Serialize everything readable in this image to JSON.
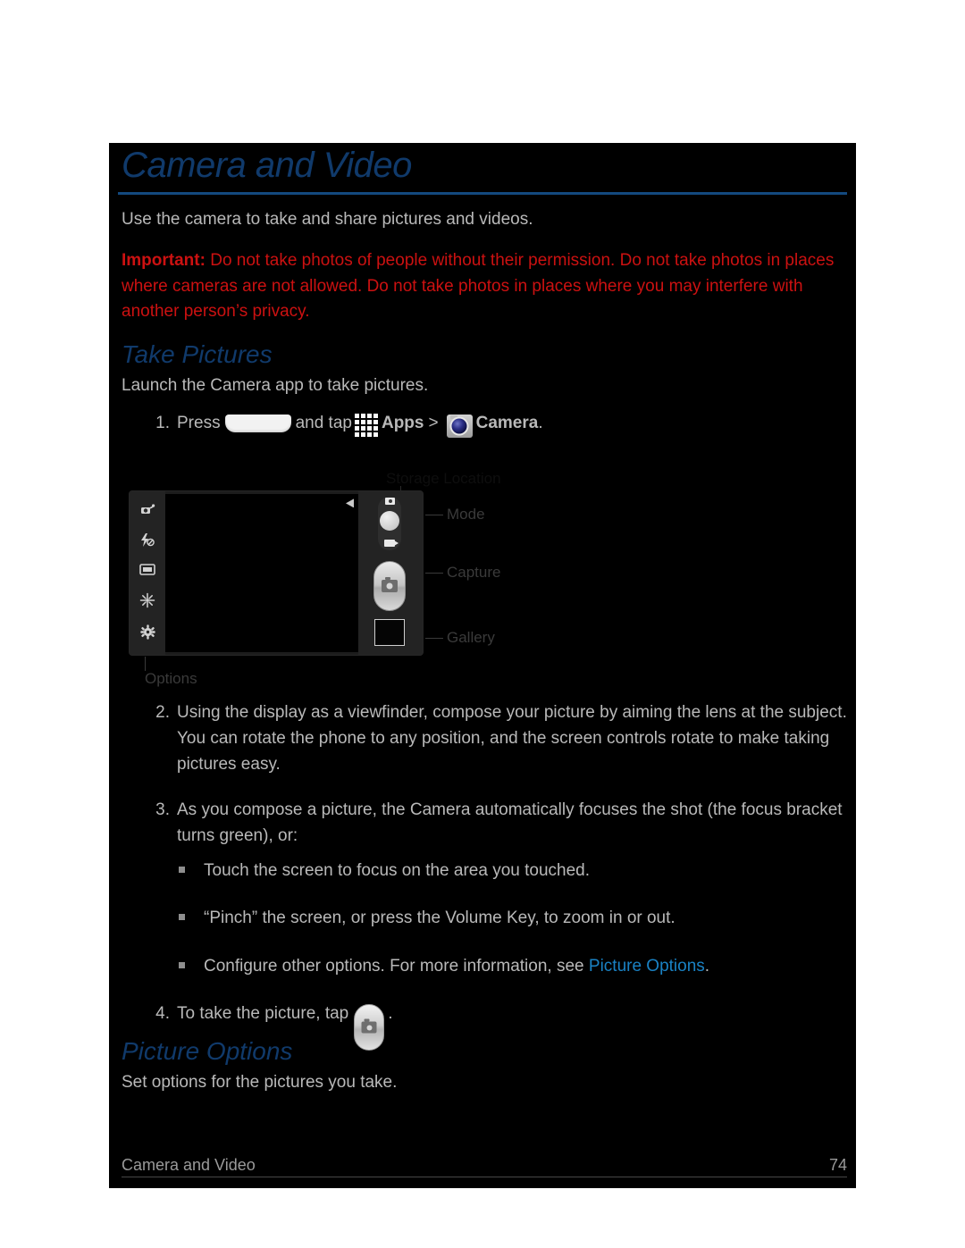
{
  "page": {
    "title": "Camera and Video",
    "intro": "Use the camera to take and share pictures and videos.",
    "important_label": "Important:",
    "important_text": " Do not take photos of people without their permission. Do not take photos in places where cameras are not allowed. Do not take photos in places where you may interfere with another person’s privacy.",
    "accent_heading_color": "#103a6b",
    "accent_rule_color": "#13497f",
    "link_color": "#1a82c4",
    "warning_color": "#cc1111",
    "body_color": "#b9b9b9",
    "background_color": "#000000"
  },
  "sections": [
    {
      "heading": "Take Pictures",
      "lead": "Launch the Camera app to take pictures."
    },
    {
      "heading": "Picture Options",
      "lead": "Set options for the pictures you take."
    }
  ],
  "steps": [
    {
      "number": "1.",
      "prefix": "Press",
      "mid": "and tap",
      "apps_label": "Apps",
      "separator": ">",
      "camera_label": "Camera",
      "suffix": "."
    },
    {
      "number": "2.",
      "text": "Using the display as a viewfinder, compose your picture by aiming the lens at the subject. You can rotate the phone to any position, and the screen controls rotate to make taking pictures easy."
    },
    {
      "number": "3.",
      "text": "As you compose a picture, the Camera automatically focuses the shot (the focus bracket turns green), or:"
    },
    {
      "number": "4.",
      "prefix": "To take the picture, tap",
      "suffix": "."
    }
  ],
  "bullets": [
    {
      "text": "Touch the screen to focus on the area you touched.",
      "link": null,
      "after": null
    },
    {
      "text": "“Pinch” the screen, or press the Volume Key, to zoom in or out.",
      "link": null,
      "after": null
    },
    {
      "text": "Configure other options. For more information, see ",
      "link": "Picture Options",
      "after": "."
    }
  ],
  "figure": {
    "caption_top": "Storage Location",
    "label_mode": "Mode",
    "label_capture": "Capture",
    "label_gallery": "Gallery",
    "label_options": "Options",
    "option_icons": [
      "self-shot-icon",
      "flash-off-icon",
      "shooting-mode-icon",
      "effects-icon",
      "settings-icon"
    ],
    "option_glyphs": [
      "◔",
      "⚡",
      "▣",
      "✳",
      "⚙"
    ]
  },
  "footer": {
    "left": "Camera and Video",
    "right": "74"
  }
}
